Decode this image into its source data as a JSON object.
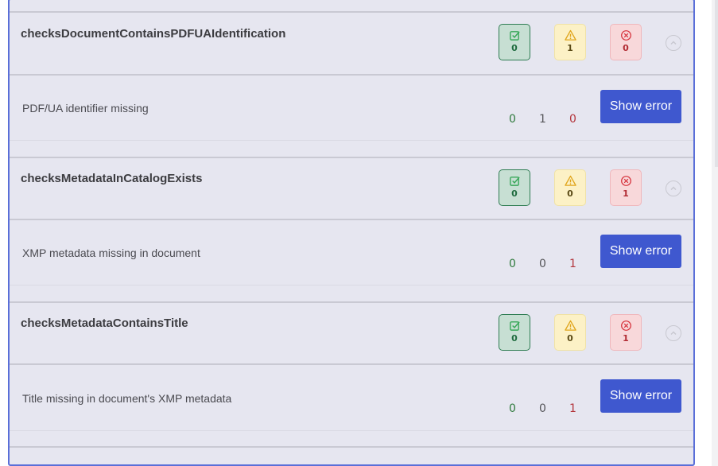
{
  "checks": [
    {
      "title": "checksDocumentContainsPDFUAIdentification",
      "badges": {
        "passed": "0",
        "warnings": "1",
        "failed": "0"
      },
      "rows": [
        {
          "message": "PDF/UA identifier missing",
          "passed": "0",
          "warnings": "1",
          "failed": "0",
          "button": "Show error"
        }
      ]
    },
    {
      "title": "checksMetadataInCatalogExists",
      "badges": {
        "passed": "0",
        "warnings": "0",
        "failed": "1"
      },
      "rows": [
        {
          "message": "XMP metadata missing in document",
          "passed": "0",
          "warnings": "0",
          "failed": "1",
          "button": "Show error"
        }
      ]
    },
    {
      "title": "checksMetadataContainsTitle",
      "badges": {
        "passed": "0",
        "warnings": "0",
        "failed": "1"
      },
      "rows": [
        {
          "message": "Title missing in document's XMP metadata",
          "passed": "0",
          "warnings": "0",
          "failed": "1",
          "button": "Show error"
        }
      ]
    }
  ],
  "icons": {
    "passed": "check-square-icon",
    "warnings": "warning-triangle-icon",
    "failed": "x-circle-icon",
    "collapse": "chevron-up-icon"
  },
  "colors": {
    "accent": "#3f58cf",
    "panel_border": "#5a6fd8",
    "passed": "#2e7a3c",
    "failed": "#b3353c",
    "warning_bg": "#fcf1c6"
  }
}
